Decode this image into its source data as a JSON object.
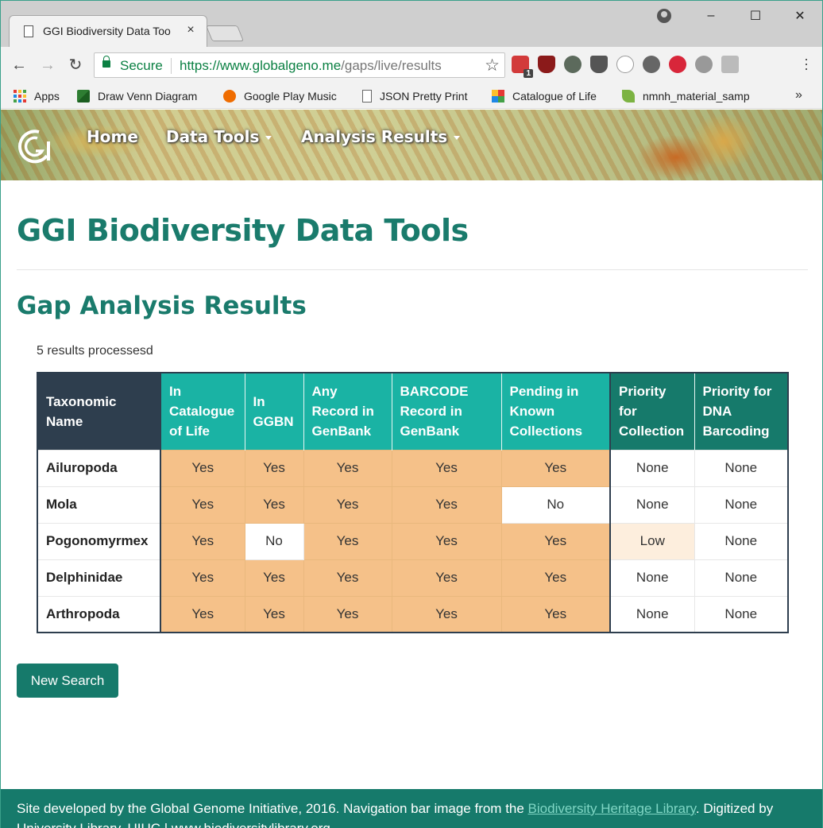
{
  "browser": {
    "tab_title": "GGI Biodiversity Data Too",
    "tab_close": "×",
    "secure_label": "Secure",
    "url_host": "https://www.globalgeno.me",
    "url_path": "/gaps/live/results",
    "controls": {
      "minimize": "–",
      "maximize": "☐",
      "close": "✕"
    },
    "nav": {
      "back": "←",
      "forward": "→",
      "reload": "↻",
      "star": "☆"
    },
    "extension_badge": "1",
    "bookmarks": [
      {
        "label": "Apps",
        "icon": "apps-grid-icon"
      },
      {
        "label": "Draw Venn Diagram",
        "icon": "venn-icon"
      },
      {
        "label": "Google Play Music",
        "icon": "play-music-icon"
      },
      {
        "label": "JSON Pretty Print",
        "icon": "page-icon"
      },
      {
        "label": "Catalogue of Life",
        "icon": "catalogue-icon"
      },
      {
        "label": "nmnh_material_samp",
        "icon": "leaf-icon"
      }
    ],
    "bookmarks_more": "»"
  },
  "site": {
    "nav": {
      "home": "Home",
      "data_tools": "Data Tools",
      "analysis_results": "Analysis Results"
    },
    "page_title": "GGI Biodiversity Data Tools",
    "section_title": "Gap Analysis Results",
    "results_count": "5 results processesd",
    "table": {
      "headers": [
        "Taxonomic Name",
        "In Catalogue of Life",
        "In GGBN",
        "Any Record in GenBank",
        "BARCODE Record in GenBank",
        "Pending in Known Collections",
        "Priority for Collection",
        "Priority for DNA Barcoding"
      ],
      "rows": [
        {
          "name": "Ailuropoda",
          "col": "Yes",
          "ggbn": "Yes",
          "genbank": "Yes",
          "barcode": "Yes",
          "pending": "Yes",
          "prio_collection": "None",
          "prio_barcoding": "None"
        },
        {
          "name": "Mola",
          "col": "Yes",
          "ggbn": "Yes",
          "genbank": "Yes",
          "barcode": "Yes",
          "pending": "No",
          "prio_collection": "None",
          "prio_barcoding": "None"
        },
        {
          "name": "Pogonomyrmex",
          "col": "Yes",
          "ggbn": "No",
          "genbank": "Yes",
          "barcode": "Yes",
          "pending": "Yes",
          "prio_collection": "Low",
          "prio_barcoding": "None"
        },
        {
          "name": "Delphinidae",
          "col": "Yes",
          "ggbn": "Yes",
          "genbank": "Yes",
          "barcode": "Yes",
          "pending": "Yes",
          "prio_collection": "None",
          "prio_barcoding": "None"
        },
        {
          "name": "Arthropoda",
          "col": "Yes",
          "ggbn": "Yes",
          "genbank": "Yes",
          "barcode": "Yes",
          "pending": "Yes",
          "prio_collection": "None",
          "prio_barcoding": "None"
        }
      ]
    },
    "new_search_label": "New Search",
    "footer": {
      "text_before": "Site developed by the Global Genome Initiative, 2016. Navigation bar image from the ",
      "link": "Biodiversity Heritage Library",
      "text_after": ". Digitized by",
      "line2": "University Library, UIUC | www.biodiversitylibrary.org"
    }
  },
  "colors": {
    "brand": "#167a6b",
    "heading": "#1a7b6c",
    "header_teal": "#1ab3a4",
    "header_dark": "#2e3e4e",
    "yes_cell": "#f5c189",
    "low_cell": "#fdeedd"
  }
}
